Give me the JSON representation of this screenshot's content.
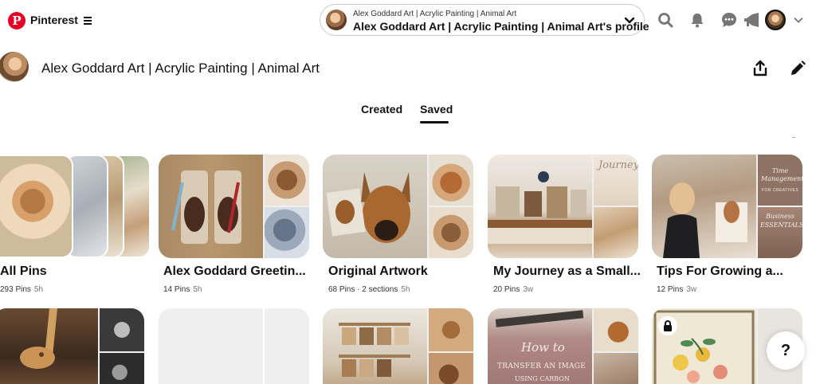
{
  "header": {
    "brand": "Pinterest",
    "profile_switch": {
      "small_label": "Alex Goddard Art | Acrylic Painting | Animal Art",
      "big_label": "Alex Goddard Art | Acrylic Painting | Animal Art's profile"
    },
    "icons": [
      "pinterest-logo",
      "menu-icon",
      "chevron-down-icon",
      "search-icon",
      "bell-icon",
      "chat-icon",
      "megaphone-icon",
      "avatar",
      "chevron-down-icon"
    ]
  },
  "profile": {
    "title": "Alex Goddard Art | Acrylic Painting | Animal Art"
  },
  "tabs": [
    {
      "label": "Created",
      "active": false
    },
    {
      "label": "Saved",
      "active": true
    }
  ],
  "boards": [
    {
      "name": "All Pins",
      "pins": "293 Pins",
      "time": "5h"
    },
    {
      "name": "Alex Goddard Greetin...",
      "pins": "14 Pins",
      "time": "5h"
    },
    {
      "name": "Original Artwork",
      "pins": "68 Pins · 2 sections",
      "time": "5h"
    },
    {
      "name": "My Journey as a Small...",
      "pins": "20 Pins",
      "time": "3w"
    },
    {
      "name": "Tips For Growing a...",
      "pins": "12 Pins",
      "time": "3w"
    }
  ],
  "cover_text": {
    "journey": "Journey",
    "time_management": "Time Management",
    "for_creatives": "FOR CREATIVES",
    "business_essentials": "Business ESSENTIALS",
    "how_to": "How to",
    "transfer": "TRANSFER AN IMAGE",
    "using_carbon": "USING CARBON"
  },
  "help": "?",
  "colors": {
    "brand_red": "#e60023"
  }
}
